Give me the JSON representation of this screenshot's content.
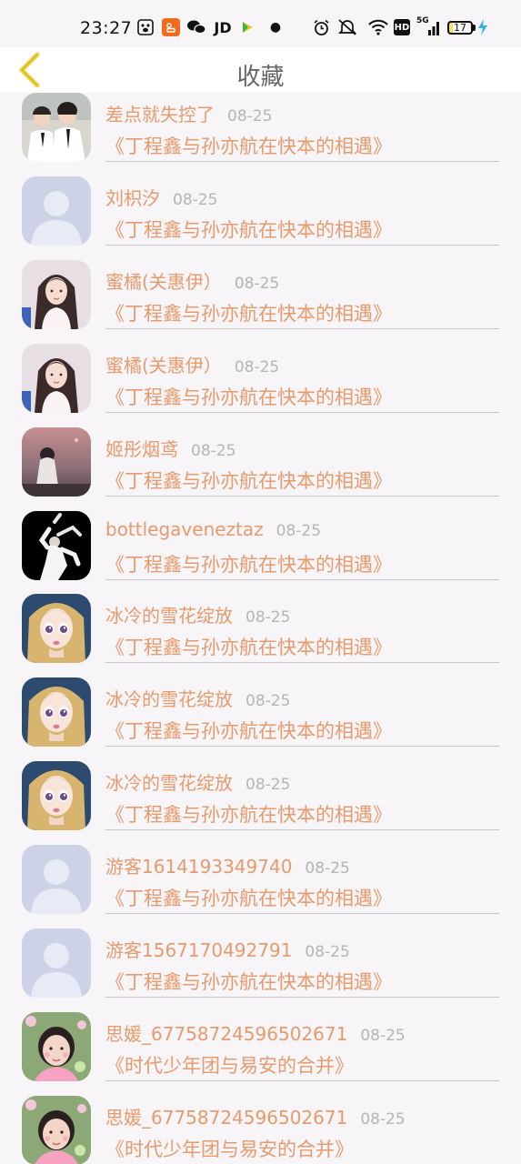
{
  "status_bar": {
    "time": "23:27",
    "hd_label": "HD",
    "signal_label": "5G",
    "battery_level": "17",
    "icons": [
      "paw-app-icon",
      "orange-app-icon",
      "wechat-icon",
      "jd-icon",
      "video-play-icon",
      "dot-icon",
      "alarm-icon",
      "mute-icon",
      "wifi-icon",
      "hd-icon",
      "signal-icon",
      "battery-icon",
      "charging-icon"
    ]
  },
  "header": {
    "title": "收藏",
    "back_icon": "chevron-left-icon",
    "accent_color": "#f0d53a"
  },
  "colors": {
    "text_accent": "#e89a6c",
    "date_gray": "#b5b5b5",
    "background": "#f7f5f7"
  },
  "favorites": [
    {
      "name": "差点就失控了",
      "date": "08-25",
      "book": "《丁程鑫与孙亦航在快本的相遇》",
      "avatar": "photo-boys-avatar"
    },
    {
      "name": "刘枳汐",
      "date": "08-25",
      "book": "《丁程鑫与孙亦航在快本的相遇》",
      "avatar": "default-avatar"
    },
    {
      "name": "蜜橘(关惠伊）",
      "date": "08-25",
      "book": "《丁程鑫与孙亦航在快本的相遇》",
      "avatar": "photo-girl-avatar"
    },
    {
      "name": "蜜橘(关惠伊）",
      "date": "08-25",
      "book": "《丁程鑫与孙亦航在快本的相遇》",
      "avatar": "photo-girl-avatar"
    },
    {
      "name": "姬彤烟鸢",
      "date": "08-25",
      "book": "《丁程鑫与孙亦航在快本的相遇》",
      "avatar": "photo-dusk-avatar"
    },
    {
      "name": "bottlegaveneztaz",
      "date": "08-25",
      "book": "《丁程鑫与孙亦航在快本的相遇》",
      "avatar": "photo-dancer-avatar"
    },
    {
      "name": "冰冷的雪花绽放",
      "date": "08-25",
      "book": "《丁程鑫与孙亦航在快本的相遇》",
      "avatar": "doll-avatar"
    },
    {
      "name": "冰冷的雪花绽放",
      "date": "08-25",
      "book": "《丁程鑫与孙亦航在快本的相遇》",
      "avatar": "doll-avatar"
    },
    {
      "name": "冰冷的雪花绽放",
      "date": "08-25",
      "book": "《丁程鑫与孙亦航在快本的相遇》",
      "avatar": "doll-avatar"
    },
    {
      "name": "游客1614193349740",
      "date": "08-25",
      "book": "《丁程鑫与孙亦航在快本的相遇》",
      "avatar": "default-avatar"
    },
    {
      "name": "游客1567170492791",
      "date": "08-25",
      "book": "《丁程鑫与孙亦航在快本的相遇》",
      "avatar": "default-avatar"
    },
    {
      "name": "思媛_67758724596502671",
      "date": "08-25",
      "book": "《时代少年团与易安的合并》",
      "avatar": "photo-child-avatar"
    },
    {
      "name": "思媛_67758724596502671",
      "date": "08-25",
      "book": "《时代少年团与易安的合并》",
      "avatar": "photo-child-avatar"
    }
  ]
}
